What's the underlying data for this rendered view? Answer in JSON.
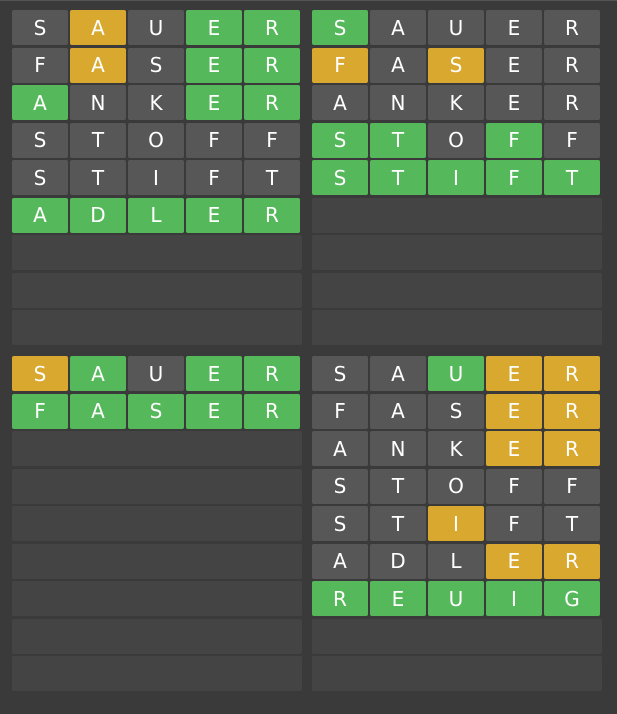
{
  "colors": {
    "background": "#3a3a3a",
    "empty_row": "#444444",
    "gray": "#575757",
    "green": "#55b85b",
    "yellow": "#d9a82e"
  },
  "boards": [
    {
      "rows": [
        [
          {
            "l": "S",
            "s": "gray"
          },
          {
            "l": "A",
            "s": "yellow"
          },
          {
            "l": "U",
            "s": "gray"
          },
          {
            "l": "E",
            "s": "green"
          },
          {
            "l": "R",
            "s": "green"
          }
        ],
        [
          {
            "l": "F",
            "s": "gray"
          },
          {
            "l": "A",
            "s": "yellow"
          },
          {
            "l": "S",
            "s": "gray"
          },
          {
            "l": "E",
            "s": "green"
          },
          {
            "l": "R",
            "s": "green"
          }
        ],
        [
          {
            "l": "A",
            "s": "green"
          },
          {
            "l": "N",
            "s": "gray"
          },
          {
            "l": "K",
            "s": "gray"
          },
          {
            "l": "E",
            "s": "green"
          },
          {
            "l": "R",
            "s": "green"
          }
        ],
        [
          {
            "l": "S",
            "s": "gray"
          },
          {
            "l": "T",
            "s": "gray"
          },
          {
            "l": "O",
            "s": "gray"
          },
          {
            "l": "F",
            "s": "gray"
          },
          {
            "l": "F",
            "s": "gray"
          }
        ],
        [
          {
            "l": "S",
            "s": "gray"
          },
          {
            "l": "T",
            "s": "gray"
          },
          {
            "l": "I",
            "s": "gray"
          },
          {
            "l": "F",
            "s": "gray"
          },
          {
            "l": "T",
            "s": "gray"
          }
        ],
        [
          {
            "l": "A",
            "s": "green"
          },
          {
            "l": "D",
            "s": "green"
          },
          {
            "l": "L",
            "s": "green"
          },
          {
            "l": "E",
            "s": "green"
          },
          {
            "l": "R",
            "s": "green"
          }
        ]
      ],
      "empty_rows": 3
    },
    {
      "rows": [
        [
          {
            "l": "S",
            "s": "green"
          },
          {
            "l": "A",
            "s": "gray"
          },
          {
            "l": "U",
            "s": "gray"
          },
          {
            "l": "E",
            "s": "gray"
          },
          {
            "l": "R",
            "s": "gray"
          }
        ],
        [
          {
            "l": "F",
            "s": "yellow"
          },
          {
            "l": "A",
            "s": "gray"
          },
          {
            "l": "S",
            "s": "yellow"
          },
          {
            "l": "E",
            "s": "gray"
          },
          {
            "l": "R",
            "s": "gray"
          }
        ],
        [
          {
            "l": "A",
            "s": "gray"
          },
          {
            "l": "N",
            "s": "gray"
          },
          {
            "l": "K",
            "s": "gray"
          },
          {
            "l": "E",
            "s": "gray"
          },
          {
            "l": "R",
            "s": "gray"
          }
        ],
        [
          {
            "l": "S",
            "s": "green"
          },
          {
            "l": "T",
            "s": "green"
          },
          {
            "l": "O",
            "s": "gray"
          },
          {
            "l": "F",
            "s": "green"
          },
          {
            "l": "F",
            "s": "gray"
          }
        ],
        [
          {
            "l": "S",
            "s": "green"
          },
          {
            "l": "T",
            "s": "green"
          },
          {
            "l": "I",
            "s": "green"
          },
          {
            "l": "F",
            "s": "green"
          },
          {
            "l": "T",
            "s": "green"
          }
        ]
      ],
      "empty_rows": 4
    },
    {
      "rows": [
        [
          {
            "l": "S",
            "s": "yellow"
          },
          {
            "l": "A",
            "s": "green"
          },
          {
            "l": "U",
            "s": "gray"
          },
          {
            "l": "E",
            "s": "green"
          },
          {
            "l": "R",
            "s": "green"
          }
        ],
        [
          {
            "l": "F",
            "s": "green"
          },
          {
            "l": "A",
            "s": "green"
          },
          {
            "l": "S",
            "s": "green"
          },
          {
            "l": "E",
            "s": "green"
          },
          {
            "l": "R",
            "s": "green"
          }
        ]
      ],
      "empty_rows": 7
    },
    {
      "rows": [
        [
          {
            "l": "S",
            "s": "gray"
          },
          {
            "l": "A",
            "s": "gray"
          },
          {
            "l": "U",
            "s": "green"
          },
          {
            "l": "E",
            "s": "yellow"
          },
          {
            "l": "R",
            "s": "yellow"
          }
        ],
        [
          {
            "l": "F",
            "s": "gray"
          },
          {
            "l": "A",
            "s": "gray"
          },
          {
            "l": "S",
            "s": "gray"
          },
          {
            "l": "E",
            "s": "yellow"
          },
          {
            "l": "R",
            "s": "yellow"
          }
        ],
        [
          {
            "l": "A",
            "s": "gray"
          },
          {
            "l": "N",
            "s": "gray"
          },
          {
            "l": "K",
            "s": "gray"
          },
          {
            "l": "E",
            "s": "yellow"
          },
          {
            "l": "R",
            "s": "yellow"
          }
        ],
        [
          {
            "l": "S",
            "s": "gray"
          },
          {
            "l": "T",
            "s": "gray"
          },
          {
            "l": "O",
            "s": "gray"
          },
          {
            "l": "F",
            "s": "gray"
          },
          {
            "l": "F",
            "s": "gray"
          }
        ],
        [
          {
            "l": "S",
            "s": "gray"
          },
          {
            "l": "T",
            "s": "gray"
          },
          {
            "l": "I",
            "s": "yellow"
          },
          {
            "l": "F",
            "s": "gray"
          },
          {
            "l": "T",
            "s": "gray"
          }
        ],
        [
          {
            "l": "A",
            "s": "gray"
          },
          {
            "l": "D",
            "s": "gray"
          },
          {
            "l": "L",
            "s": "gray"
          },
          {
            "l": "E",
            "s": "yellow"
          },
          {
            "l": "R",
            "s": "yellow"
          }
        ],
        [
          {
            "l": "R",
            "s": "green"
          },
          {
            "l": "E",
            "s": "green"
          },
          {
            "l": "U",
            "s": "green"
          },
          {
            "l": "I",
            "s": "green"
          },
          {
            "l": "G",
            "s": "green"
          }
        ]
      ],
      "empty_rows": 2
    }
  ]
}
